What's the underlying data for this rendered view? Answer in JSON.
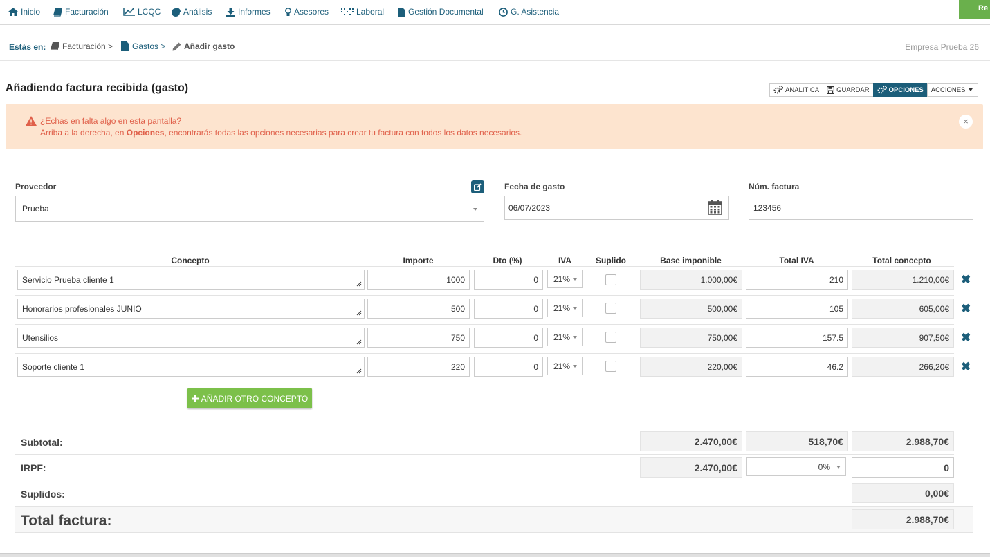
{
  "nav": {
    "items": [
      {
        "label": "Inicio",
        "icon": "home-icon"
      },
      {
        "label": "Facturación",
        "icon": "book-icon"
      },
      {
        "label": "LCQC",
        "icon": "line-chart-icon"
      },
      {
        "label": "Análisis",
        "icon": "pie-chart-icon"
      },
      {
        "label": "Informes",
        "icon": "download-icon"
      },
      {
        "label": "Asesores",
        "icon": "lightbulb-icon"
      },
      {
        "label": "Laboral",
        "icon": "grid-icon"
      },
      {
        "label": "Gestión Documental",
        "icon": "file-icon"
      },
      {
        "label": "G. Asistencia",
        "icon": "clock-icon"
      }
    ],
    "top_button_label": "Re"
  },
  "breadcrumb": {
    "prefix": "Estás en:",
    "items": [
      {
        "label": "Facturación >",
        "icon": "book-icon"
      },
      {
        "label": "Gastos >",
        "icon": "file-icon"
      },
      {
        "label": "Añadir gasto",
        "icon": "pencil-icon"
      }
    ],
    "company": "Empresa Prueba 26"
  },
  "page": {
    "title": "Añadiendo factura recibida (gasto)"
  },
  "toolbar": {
    "analitica": "ANALITICA",
    "guardar": "GUARDAR",
    "opciones": "OPCIONES",
    "acciones": "ACCIONES"
  },
  "alert": {
    "line1": "¿Echas en falta algo en esta pantalla?",
    "line2_pre": "Arriba a la derecha, en ",
    "line2_bold": "Opciones",
    "line2_post": ", encontrarás todas las opciones necesarias para crear tu factura con todos los datos necesarios.",
    "close": "×"
  },
  "form": {
    "proveedor_label": "Proveedor",
    "proveedor_value": "Prueba",
    "fecha_label": "Fecha de gasto",
    "fecha_value": "06/07/2023",
    "numfactura_label": "Núm. factura",
    "numfactura_value": "123456"
  },
  "table": {
    "headers": {
      "concepto": "Concepto",
      "importe": "Importe",
      "dto": "Dto (%)",
      "iva": "IVA",
      "suplido": "Suplido",
      "base": "Base imponible",
      "total_iva": "Total IVA",
      "total_concepto": "Total concepto"
    },
    "rows": [
      {
        "concepto": "Servicio Prueba cliente 1",
        "importe": "1000",
        "dto": "0",
        "iva": "21%",
        "base": "1.000,00€",
        "total_iva": "210",
        "total": "1.210,00€"
      },
      {
        "concepto": "Honorarios profesionales JUNIO",
        "importe": "500",
        "dto": "0",
        "iva": "21%",
        "base": "500,00€",
        "total_iva": "105",
        "total": "605,00€"
      },
      {
        "concepto": "Utensilios",
        "importe": "750",
        "dto": "0",
        "iva": "21%",
        "base": "750,00€",
        "total_iva": "157.5",
        "total": "907,50€"
      },
      {
        "concepto": "Soporte cliente 1",
        "importe": "220",
        "dto": "0",
        "iva": "21%",
        "base": "220,00€",
        "total_iva": "46.2",
        "total": "266,20€"
      }
    ],
    "add_label": "AÑADIR OTRO CONCEPTO"
  },
  "totals": {
    "subtotal_label": "Subtotal:",
    "subtotal_base": "2.470,00€",
    "subtotal_iva": "518,70€",
    "subtotal_total": "2.988,70€",
    "irpf_label": "IRPF:",
    "irpf_base": "2.470,00€",
    "irpf_rate": "0%",
    "irpf_total": "0",
    "suplidos_label": "Suplidos:",
    "suplidos_total": "0,00€",
    "total_label": "Total factura:",
    "total_value": "2.988,70€"
  },
  "colors": {
    "accent": "#1c5e7a",
    "green": "#7cc04a",
    "alert_bg": "#fde4cf",
    "alert_text": "#e0604a"
  }
}
